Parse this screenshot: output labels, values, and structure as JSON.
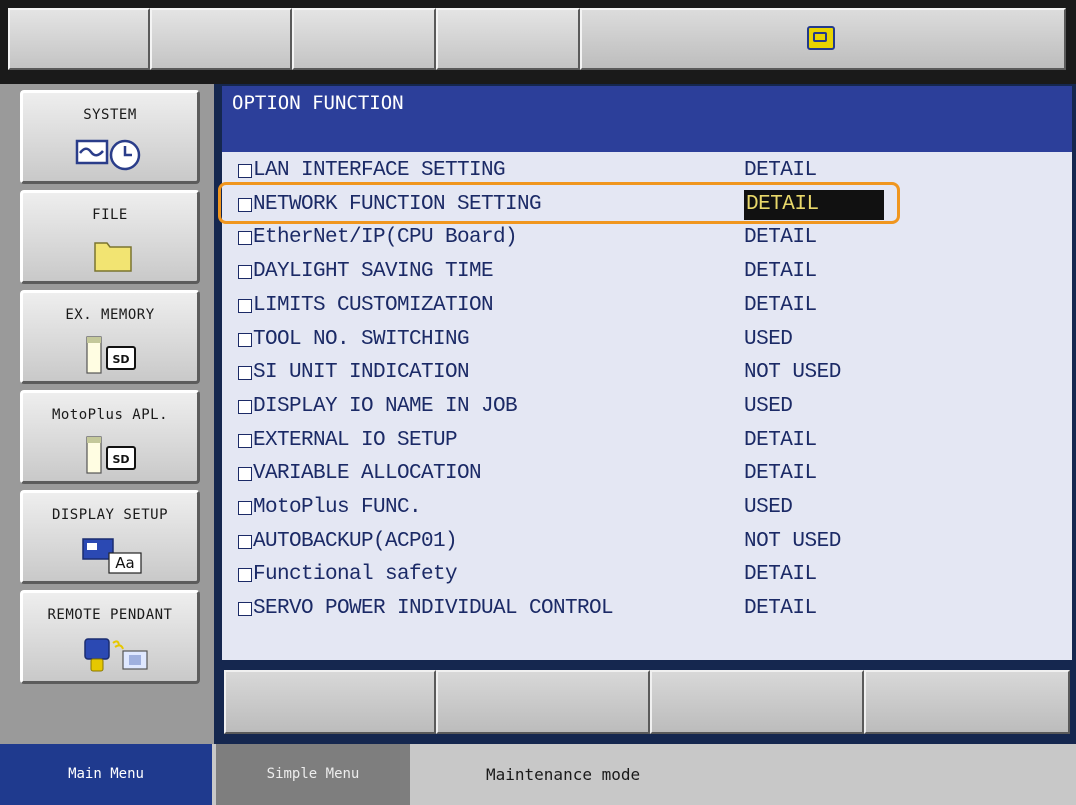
{
  "top_toolbar": {
    "status_icon": "pendant-status-icon"
  },
  "left_menu": {
    "items": [
      {
        "label": "SYSTEM",
        "icon": "system-monitor-clock-icon"
      },
      {
        "label": "FILE",
        "icon": "folder-icon"
      },
      {
        "label": "EX. MEMORY",
        "icon": "sd-card-icon"
      },
      {
        "label": "MotoPlus APL.",
        "icon": "sd-card-icon"
      },
      {
        "label": "DISPLAY SETUP",
        "icon": "display-font-icon"
      },
      {
        "label": "REMOTE PENDANT",
        "icon": "remote-pendant-icon"
      }
    ]
  },
  "main": {
    "title": "OPTION FUNCTION",
    "rows": [
      {
        "label": "LAN INTERFACE SETTING",
        "value": "DETAIL"
      },
      {
        "label": "NETWORK FUNCTION SETTING",
        "value": "DETAIL",
        "selected": true
      },
      {
        "label": "EtherNet/IP(CPU Board)",
        "value": "DETAIL"
      },
      {
        "label": "DAYLIGHT SAVING TIME",
        "value": "DETAIL"
      },
      {
        "label": "LIMITS CUSTOMIZATION",
        "value": "DETAIL"
      },
      {
        "label": "TOOL NO. SWITCHING",
        "value": "USED"
      },
      {
        "label": "SI UNIT INDICATION",
        "value": "NOT USED"
      },
      {
        "label": "DISPLAY IO NAME IN JOB",
        "value": "USED"
      },
      {
        "label": "EXTERNAL IO SETUP",
        "value": "DETAIL"
      },
      {
        "label": "VARIABLE ALLOCATION",
        "value": "DETAIL"
      },
      {
        "label": "MotoPlus FUNC.",
        "value": "USED"
      },
      {
        "label": "AUTOBACKUP(ACP01)",
        "value": "NOT USED"
      },
      {
        "label": "Functional safety",
        "value": "DETAIL"
      },
      {
        "label": "SERVO POWER INDIVIDUAL CONTROL",
        "value": "DETAIL"
      }
    ]
  },
  "bottom": {
    "main_menu": "Main Menu",
    "simple_menu": "Simple Menu",
    "mode": "Maintenance mode"
  },
  "colors": {
    "title_bar": "#2c3f9a",
    "list_bg": "#e4e7f3",
    "list_text": "#1b2a66",
    "highlight": "#f0961e",
    "selected_bg": "#111111",
    "selected_text": "#e8d86a",
    "main_menu_tab": "#1f3a8e"
  }
}
